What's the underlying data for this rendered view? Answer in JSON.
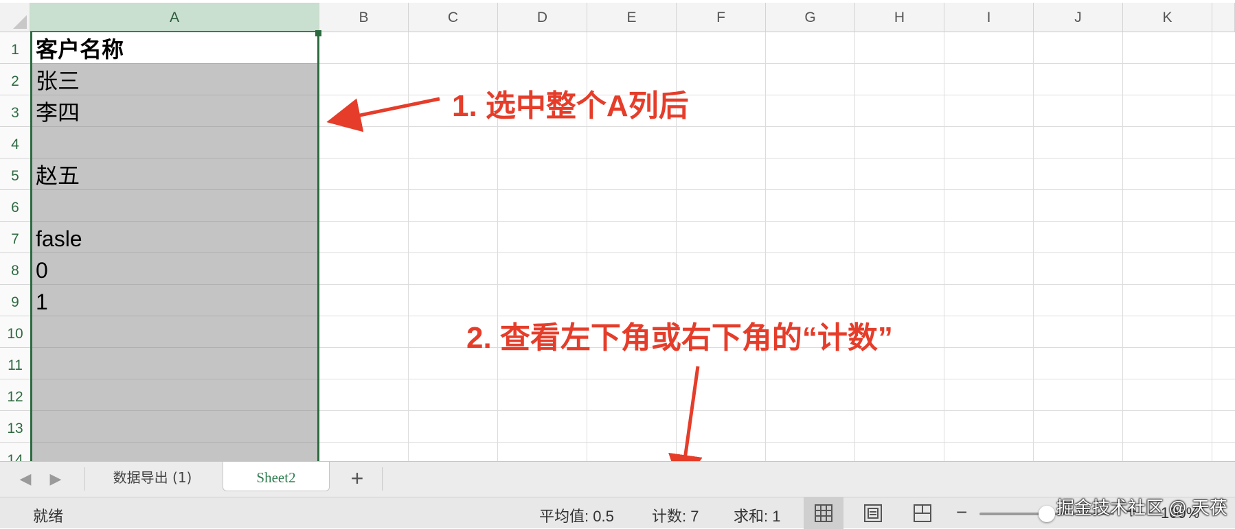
{
  "sheet": {
    "columns": [
      "A",
      "B",
      "C",
      "D",
      "E",
      "F",
      "G",
      "H",
      "I",
      "J",
      "K"
    ],
    "selected_column": "A",
    "row_numbers": [
      "1",
      "2",
      "3",
      "4",
      "5",
      "6",
      "7",
      "8",
      "9",
      "10",
      "11",
      "12",
      "13",
      "14"
    ],
    "cells_A": [
      "客户名称",
      "张三",
      "李四",
      "",
      "赵五",
      "",
      "fasle",
      "0",
      "1",
      "",
      "",
      "",
      ""
    ]
  },
  "annotations": {
    "note1": "1. 选中整个A列后",
    "note2": "2. 查看左下角或右下角的“计数”",
    "color": "#e53d2a"
  },
  "tabs": {
    "sheets": [
      "数据导出 (1)",
      "Sheet2"
    ],
    "active": "Sheet2",
    "add_label": "+",
    "prev_icon": "chevron-left-icon",
    "next_icon": "chevron-right-icon"
  },
  "status": {
    "ready": "就绪",
    "average": "平均值: 0.5",
    "count": "计数: 7",
    "sum": "求和: 1",
    "zoom_level": "100%",
    "zoom_minus": "−",
    "zoom_plus": "+"
  },
  "watermark": "掘金技术社区 @ 天茯",
  "colors": {
    "selection_border": "#2b6b3e",
    "selection_fill": "#c4c4c4",
    "header_selected": "#c9dfcf"
  }
}
